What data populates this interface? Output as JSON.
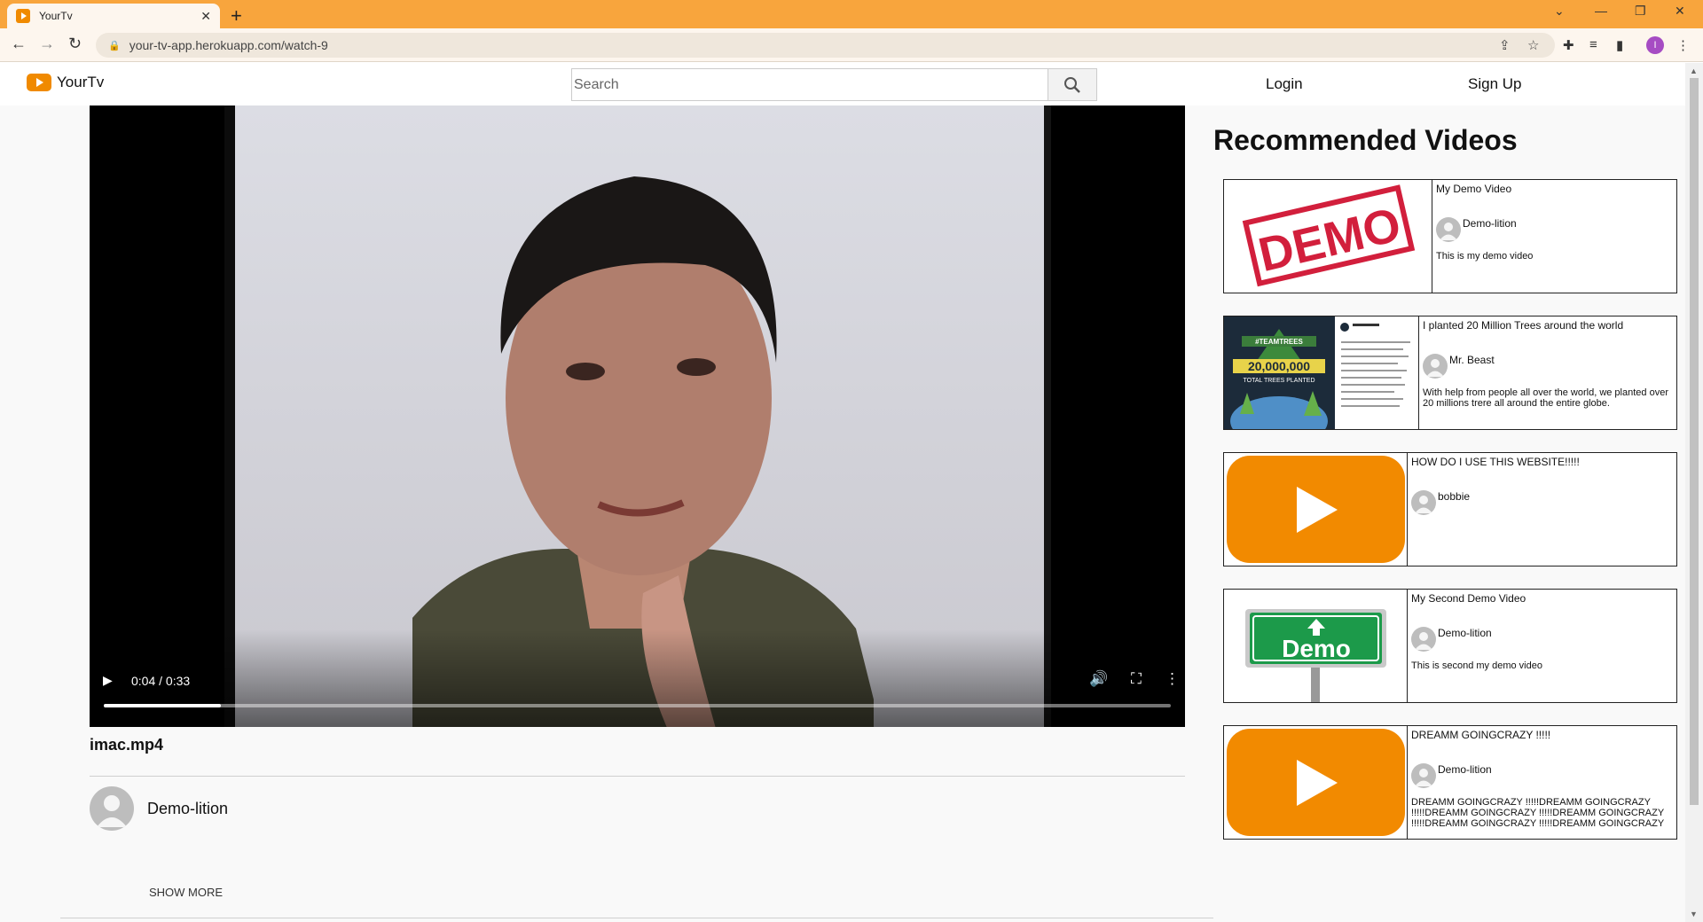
{
  "browser": {
    "tab_title": "YourTv",
    "tab_close": "✕",
    "new_tab": "+",
    "url": "your-tv-app.herokuapp.com/watch-9",
    "profile_initial": "I"
  },
  "header": {
    "logo_text": "YourTv",
    "search_placeholder": "Search",
    "login": "Login",
    "signup": "Sign Up"
  },
  "player": {
    "time": "0:04 / 0:33",
    "progress": 0.11
  },
  "video": {
    "title": "imac.mp4",
    "channel": "Demo-lition",
    "show_more": "SHOW MORE"
  },
  "recommended": {
    "heading": "Recommended Videos",
    "items": [
      {
        "title": "My Demo Video",
        "channel": "Demo-lition",
        "description": "This is my demo video",
        "thumb": "DEMO"
      },
      {
        "title": "I planted 20 Million Trees around the world",
        "channel": "Mr. Beast",
        "description": "With help from people all over the world, we planted over 20 millions trere all around the entire globe.",
        "thumb": "20,000,000"
      },
      {
        "title": "HOW DO I USE THIS WEBSITE!!!!!",
        "channel": "bobbie",
        "description": "",
        "thumb": ""
      },
      {
        "title": "My Second Demo Video",
        "channel": "Demo-lition",
        "description": "This is second my demo video",
        "thumb": "Demo"
      },
      {
        "title": "DREAMM GOINGCRAZY !!!!!",
        "channel": "Demo-lition",
        "description": "DREAMM GOINGCRAZY !!!!!DREAMM GOINGCRAZY !!!!!DREAMM GOINGCRAZY !!!!!DREAMM GOINGCRAZY !!!!!DREAMM GOINGCRAZY !!!!!DREAMM GOINGCRAZY",
        "thumb": ""
      }
    ]
  },
  "thumb_text": {
    "teamtrees_tag": "#TEAMTREES",
    "teamtrees_sub": "TOTAL TREES PLANTED"
  },
  "colors": {
    "accent": "#f08a00",
    "tabbar": "#f8a53d"
  }
}
